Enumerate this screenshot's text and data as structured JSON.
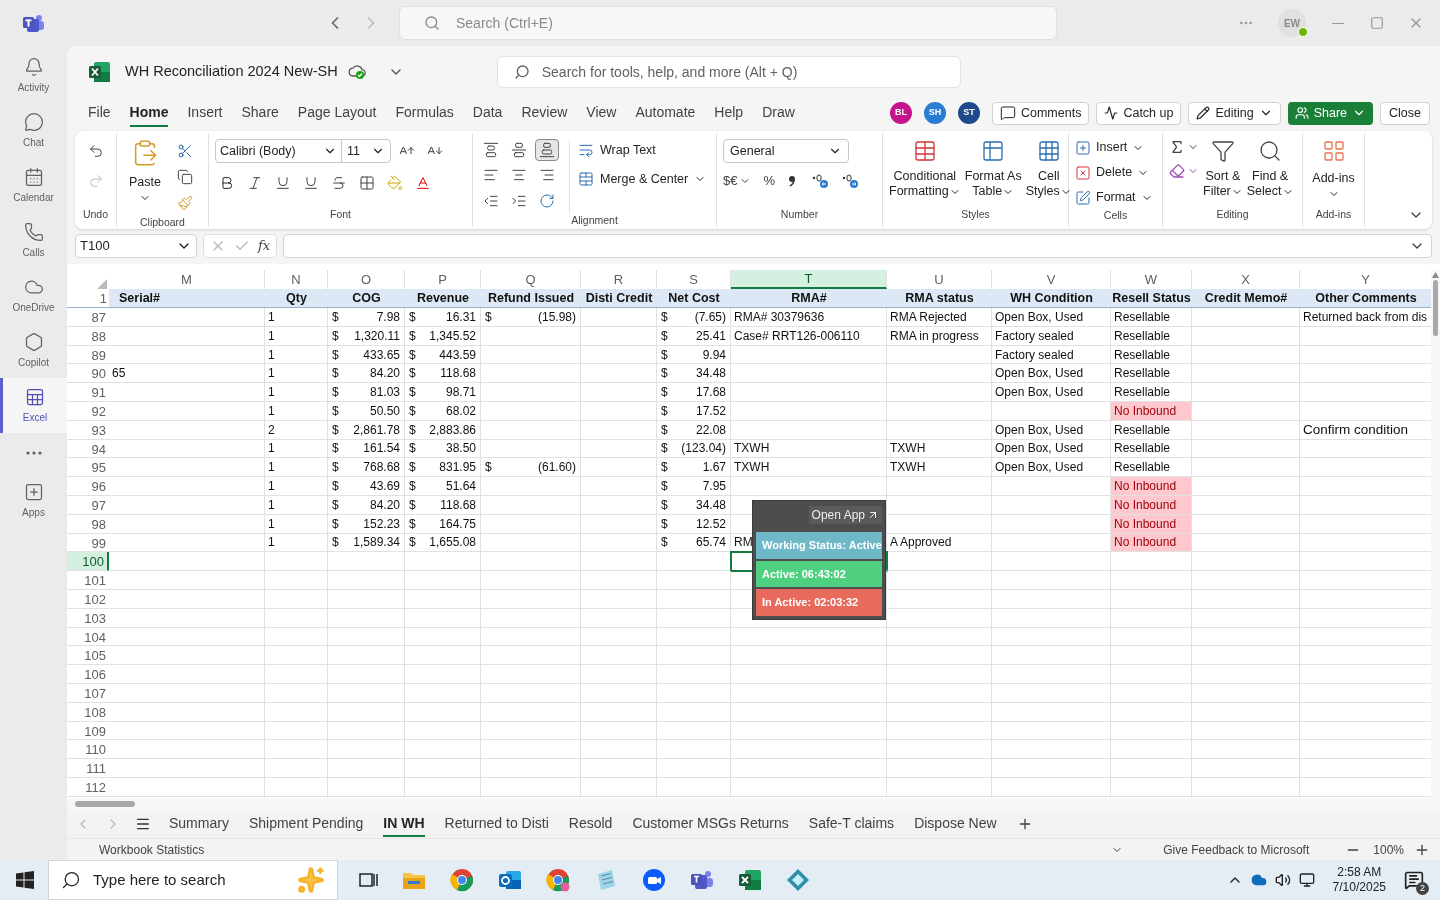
{
  "teams_bar": {
    "search_placeholder": "Search (Ctrl+E)",
    "user_initials": "EW"
  },
  "rail": {
    "items": [
      {
        "label": "Activity",
        "selected": false
      },
      {
        "label": "Chat",
        "selected": false
      },
      {
        "label": "Calendar",
        "selected": false
      },
      {
        "label": "Calls",
        "selected": false
      },
      {
        "label": "OneDrive",
        "selected": false
      },
      {
        "label": "Copilot",
        "selected": false
      },
      {
        "label": "Excel",
        "selected": true
      },
      {
        "label": "Apps",
        "selected": false
      }
    ]
  },
  "workbook": {
    "title": "WH Reconciliation 2024 New-SH",
    "search_placeholder": "Search for tools, help, and more (Alt + Q)"
  },
  "menu_tabs": [
    {
      "label": "File",
      "selected": false
    },
    {
      "label": "Home",
      "selected": true
    },
    {
      "label": "Insert",
      "selected": false
    },
    {
      "label": "Share",
      "selected": false
    },
    {
      "label": "Page Layout",
      "selected": false
    },
    {
      "label": "Formulas",
      "selected": false
    },
    {
      "label": "Data",
      "selected": false
    },
    {
      "label": "Review",
      "selected": false
    },
    {
      "label": "View",
      "selected": false
    },
    {
      "label": "Automate",
      "selected": false
    },
    {
      "label": "Help",
      "selected": false
    },
    {
      "label": "Draw",
      "selected": false
    }
  ],
  "collaborators": [
    {
      "initials": "BL",
      "color": "#c4158d"
    },
    {
      "initials": "SH",
      "color": "#2b7cd3"
    },
    {
      "initials": "ST",
      "color": "#1e4a8c"
    }
  ],
  "header_buttons": {
    "comments": "Comments",
    "catch_up": "Catch up",
    "editing": "Editing",
    "share": "Share",
    "close": "Close"
  },
  "ribbon": {
    "undo_label": "Undo",
    "clipboard": {
      "paste": "Paste",
      "label": "Clipboard"
    },
    "font": {
      "family": "Calibri (Body)",
      "size": "11",
      "label": "Font"
    },
    "alignment": {
      "vertical": [
        {
          "selected": false
        },
        {
          "selected": false
        },
        {
          "selected": true
        }
      ],
      "wrap": "Wrap Text",
      "merge": "Merge & Center",
      "label": "Alignment"
    },
    "number": {
      "format": "General",
      "currency": "$€",
      "percent": "%",
      "label": "Number"
    },
    "styles": {
      "buttons": [
        {
          "line1": "Conditional",
          "line2": "Formatting"
        },
        {
          "line1": "Format As",
          "line2": "Table"
        },
        {
          "line1": "Cell",
          "line2": "Styles"
        }
      ],
      "label": "Styles"
    },
    "cells": {
      "buttons": [
        "Insert",
        "Delete",
        "Format"
      ],
      "label": "Cells"
    },
    "editing": {
      "buttons": [
        {
          "line1": "Sort &",
          "line2": "Filter"
        },
        {
          "line1": "Find &",
          "line2": "Select"
        }
      ],
      "label": "Editing"
    },
    "addins": {
      "button": "Add-ins",
      "label": "Add-ins"
    }
  },
  "formula_bar": {
    "name_box": "T100",
    "function_label": "fx"
  },
  "grid": {
    "columns": [
      {
        "letter": "M",
        "header": "Serial#",
        "selected": false
      },
      {
        "letter": "N",
        "header": "Qty",
        "selected": false
      },
      {
        "letter": "O",
        "header": "COG",
        "selected": false
      },
      {
        "letter": "P",
        "header": "Revenue",
        "selected": false
      },
      {
        "letter": "Q",
        "header": "Refund Issued",
        "selected": false
      },
      {
        "letter": "R",
        "header": "Disti Credit",
        "selected": false
      },
      {
        "letter": "S",
        "header": "Net Cost",
        "selected": false
      },
      {
        "letter": "T",
        "header": "RMA#",
        "selected": true
      },
      {
        "letter": "U",
        "header": "RMA status",
        "selected": false
      },
      {
        "letter": "V",
        "header": "WH Condition",
        "selected": false
      },
      {
        "letter": "W",
        "header": "Resell Status",
        "selected": false
      },
      {
        "letter": "X",
        "header": "Credit Memo#",
        "selected": false
      },
      {
        "letter": "Y",
        "header": "Other Comments",
        "selected": false
      }
    ],
    "header_row": "1",
    "rows": [
      {
        "number": "87",
        "selected": false,
        "cells": {
          "N": {
            "kind": "text",
            "text": "1"
          },
          "O": {
            "kind": "currency",
            "symbol": "$",
            "amount": "7.98"
          },
          "P": {
            "kind": "currency",
            "symbol": "$",
            "amount": "16.31"
          },
          "Q": {
            "kind": "currency",
            "symbol": "$",
            "amount": "(15.98)"
          },
          "S": {
            "kind": "currency",
            "symbol": "$",
            "amount": "(7.65)"
          },
          "T": {
            "kind": "text",
            "text": "RMA# 30379636"
          },
          "U": {
            "kind": "text",
            "text": "RMA Rejected"
          },
          "V": {
            "kind": "text",
            "text": "Open Box, Used"
          },
          "W": {
            "kind": "text",
            "text": "Resellable"
          },
          "Y": {
            "kind": "text",
            "text": "Returned back from dis"
          }
        }
      },
      {
        "number": "88",
        "selected": false,
        "cells": {
          "N": {
            "kind": "text",
            "text": "1"
          },
          "O": {
            "kind": "currency",
            "symbol": "$",
            "amount": "1,320.11"
          },
          "P": {
            "kind": "currency",
            "symbol": "$",
            "amount": "1,345.52"
          },
          "S": {
            "kind": "currency",
            "symbol": "$",
            "amount": "25.41"
          },
          "T": {
            "kind": "text",
            "text": "Case# RRT126-006110"
          },
          "U": {
            "kind": "text",
            "text": "RMA in progress"
          },
          "V": {
            "kind": "text",
            "text": "Factory sealed"
          },
          "W": {
            "kind": "text",
            "text": "Resellable"
          }
        }
      },
      {
        "number": "89",
        "selected": false,
        "cells": {
          "N": {
            "kind": "text",
            "text": "1"
          },
          "O": {
            "kind": "currency",
            "symbol": "$",
            "amount": "433.65"
          },
          "P": {
            "kind": "currency",
            "symbol": "$",
            "amount": "443.59"
          },
          "S": {
            "kind": "currency",
            "symbol": "$",
            "amount": "9.94"
          },
          "V": {
            "kind": "text",
            "text": "Factory sealed"
          },
          "W": {
            "kind": "text",
            "text": "Resellable"
          }
        }
      },
      {
        "number": "90",
        "selected": false,
        "cells": {
          "M": {
            "kind": "text",
            "text": "65"
          },
          "N": {
            "kind": "text",
            "text": "1"
          },
          "O": {
            "kind": "currency",
            "symbol": "$",
            "amount": "84.20"
          },
          "P": {
            "kind": "currency",
            "symbol": "$",
            "amount": "118.68"
          },
          "S": {
            "kind": "currency",
            "symbol": "$",
            "amount": "34.48"
          },
          "V": {
            "kind": "text",
            "text": "Open Box, Used"
          },
          "W": {
            "kind": "text",
            "text": "Resellable"
          }
        }
      },
      {
        "number": "91",
        "selected": false,
        "cells": {
          "N": {
            "kind": "text",
            "text": "1"
          },
          "O": {
            "kind": "currency",
            "symbol": "$",
            "amount": "81.03"
          },
          "P": {
            "kind": "currency",
            "symbol": "$",
            "amount": "98.71"
          },
          "S": {
            "kind": "currency",
            "symbol": "$",
            "amount": "17.68"
          },
          "V": {
            "kind": "text",
            "text": "Open Box, Used"
          },
          "W": {
            "kind": "text",
            "text": "Resellable"
          }
        }
      },
      {
        "number": "92",
        "selected": false,
        "cells": {
          "N": {
            "kind": "text",
            "text": "1"
          },
          "O": {
            "kind": "currency",
            "symbol": "$",
            "amount": "50.50"
          },
          "P": {
            "kind": "currency",
            "symbol": "$",
            "amount": "68.02"
          },
          "S": {
            "kind": "currency",
            "symbol": "$",
            "amount": "17.52"
          },
          "W": {
            "kind": "alert",
            "text": "No Inbound"
          }
        }
      },
      {
        "number": "93",
        "selected": false,
        "cells": {
          "N": {
            "kind": "text",
            "text": "2"
          },
          "O": {
            "kind": "currency",
            "symbol": "$",
            "amount": "2,861.78"
          },
          "P": {
            "kind": "currency",
            "symbol": "$",
            "amount": "2,883.86"
          },
          "S": {
            "kind": "currency",
            "symbol": "$",
            "amount": "22.08"
          },
          "V": {
            "kind": "text",
            "text": "Open Box, Used"
          },
          "W": {
            "kind": "text",
            "text": "Resellable"
          },
          "Y": {
            "kind": "large",
            "text": "Confirm condition"
          }
        }
      },
      {
        "number": "94",
        "selected": false,
        "cells": {
          "N": {
            "kind": "text",
            "text": "1"
          },
          "O": {
            "kind": "currency",
            "symbol": "$",
            "amount": "161.54"
          },
          "P": {
            "kind": "currency",
            "symbol": "$",
            "amount": "38.50"
          },
          "S": {
            "kind": "currency",
            "symbol": "$",
            "amount": "(123.04)"
          },
          "T": {
            "kind": "text",
            "text": "TXWH"
          },
          "U": {
            "kind": "text",
            "text": "TXWH"
          },
          "V": {
            "kind": "text",
            "text": "Open Box, Used"
          },
          "W": {
            "kind": "text",
            "text": "Resellable"
          }
        }
      },
      {
        "number": "95",
        "selected": false,
        "cells": {
          "N": {
            "kind": "text",
            "text": "1"
          },
          "O": {
            "kind": "currency",
            "symbol": "$",
            "amount": "768.68"
          },
          "P": {
            "kind": "currency",
            "symbol": "$",
            "amount": "831.95"
          },
          "Q": {
            "kind": "currency",
            "symbol": "$",
            "amount": "(61.60)"
          },
          "S": {
            "kind": "currency",
            "symbol": "$",
            "amount": "1.67"
          },
          "T": {
            "kind": "text",
            "text": "TXWH"
          },
          "U": {
            "kind": "text",
            "text": "TXWH"
          },
          "V": {
            "kind": "text",
            "text": "Open Box, Used"
          },
          "W": {
            "kind": "text",
            "text": "Resellable"
          }
        }
      },
      {
        "number": "96",
        "selected": false,
        "cells": {
          "N": {
            "kind": "text",
            "text": "1"
          },
          "O": {
            "kind": "currency",
            "symbol": "$",
            "amount": "43.69"
          },
          "P": {
            "kind": "currency",
            "symbol": "$",
            "amount": "51.64"
          },
          "S": {
            "kind": "currency",
            "symbol": "$",
            "amount": "7.95"
          },
          "W": {
            "kind": "alert",
            "text": "No Inbound"
          }
        }
      },
      {
        "number": "97",
        "selected": false,
        "cells": {
          "N": {
            "kind": "text",
            "text": "1"
          },
          "O": {
            "kind": "currency",
            "symbol": "$",
            "amount": "84.20"
          },
          "P": {
            "kind": "currency",
            "symbol": "$",
            "amount": "118.68"
          },
          "S": {
            "kind": "currency",
            "symbol": "$",
            "amount": "34.48"
          },
          "W": {
            "kind": "alert",
            "text": "No Inbound"
          }
        }
      },
      {
        "number": "98",
        "selected": false,
        "cells": {
          "N": {
            "kind": "text",
            "text": "1"
          },
          "O": {
            "kind": "currency",
            "symbol": "$",
            "amount": "152.23"
          },
          "P": {
            "kind": "currency",
            "symbol": "$",
            "amount": "164.75"
          },
          "S": {
            "kind": "currency",
            "symbol": "$",
            "amount": "12.52"
          },
          "W": {
            "kind": "alert",
            "text": "No Inbound"
          }
        }
      },
      {
        "number": "99",
        "selected": false,
        "cells": {
          "N": {
            "kind": "text",
            "text": "1"
          },
          "O": {
            "kind": "currency",
            "symbol": "$",
            "amount": "1,589.34"
          },
          "P": {
            "kind": "currency",
            "symbol": "$",
            "amount": "1,655.08"
          },
          "S": {
            "kind": "currency",
            "symbol": "$",
            "amount": "65.74"
          },
          "T": {
            "kind": "text",
            "text": "RM"
          },
          "U": {
            "kind": "text",
            "text": "A Approved"
          },
          "W": {
            "kind": "alert",
            "text": "No Inbound"
          }
        }
      },
      {
        "number": "100",
        "selected": true
      },
      {
        "number": "101",
        "selected": false
      },
      {
        "number": "102",
        "selected": false
      },
      {
        "number": "103",
        "selected": false
      },
      {
        "number": "104",
        "selected": false
      },
      {
        "number": "105",
        "selected": false
      },
      {
        "number": "106",
        "selected": false
      },
      {
        "number": "107",
        "selected": false
      },
      {
        "number": "108",
        "selected": false
      },
      {
        "number": "109",
        "selected": false
      },
      {
        "number": "110",
        "selected": false
      },
      {
        "number": "111",
        "selected": false
      },
      {
        "number": "112",
        "selected": false
      }
    ]
  },
  "status_popup": {
    "open_app": "Open App",
    "working_status": "Working Status: Active",
    "active": "Active: 06:43:02",
    "inactive": "In Active: 02:03:32"
  },
  "sheet_tabs": [
    {
      "label": "Summary",
      "selected": false
    },
    {
      "label": "Shipment Pending",
      "selected": false
    },
    {
      "label": "IN WH",
      "selected": true
    },
    {
      "label": "Returned to Disti",
      "selected": false
    },
    {
      "label": "Resold",
      "selected": false
    },
    {
      "label": "Customer MSGs Returns",
      "selected": false
    },
    {
      "label": "Safe-T claims",
      "selected": false
    },
    {
      "label": "Dispose New",
      "selected": false
    }
  ],
  "status_bar": {
    "statistics": "Workbook Statistics",
    "feedback": "Give Feedback to Microsoft",
    "zoom": "100%"
  },
  "taskbar": {
    "search_placeholder": "Type here to search",
    "time": "2:58 AM",
    "date": "7/10/2025",
    "notifications": "2"
  }
}
